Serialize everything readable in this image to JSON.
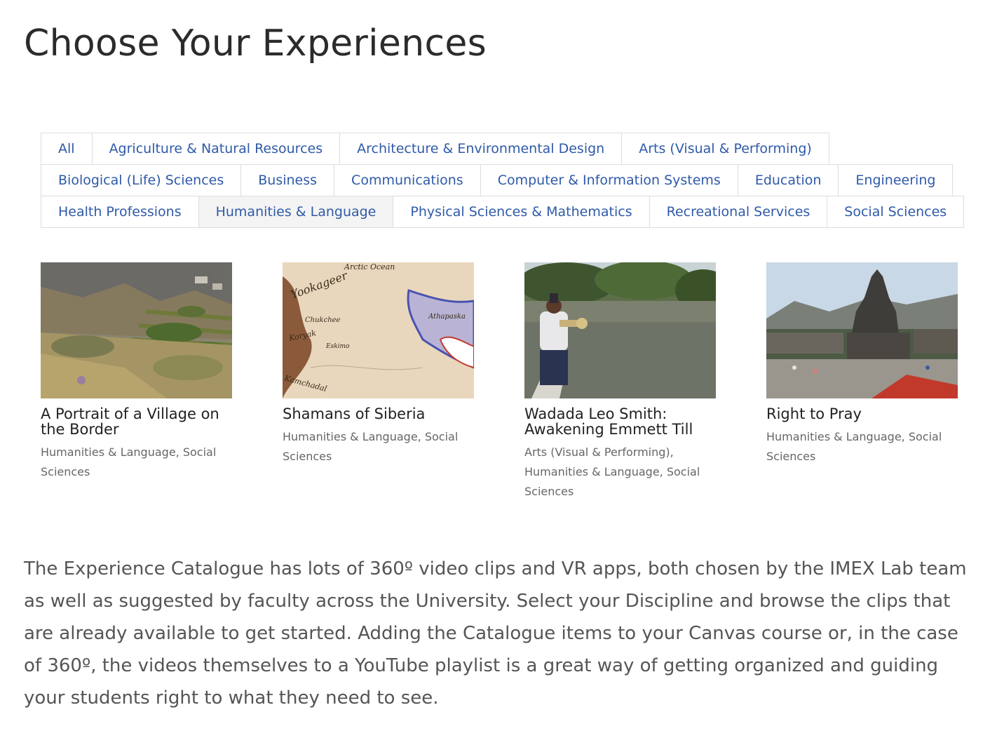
{
  "page": {
    "title": "Choose Your Experiences"
  },
  "filters": {
    "rows": [
      [
        "All",
        "Agriculture & Natural Resources",
        "Architecture & Environmental Design",
        "Arts (Visual & Performing)"
      ],
      [
        "Biological (Life) Sciences",
        "Business",
        "Communications",
        "Computer & Information Systems",
        "Education",
        "Engineering"
      ],
      [
        "Health Professions",
        "Humanities & Language",
        "Physical Sciences & Mathematics",
        "Recreational Services",
        "Social Sciences"
      ]
    ],
    "active": "Humanities & Language"
  },
  "cards": [
    {
      "title": "A Portrait of a Village on the Border",
      "tags": "Humanities & Language, Social Sciences",
      "image": "village-hillside-terraces"
    },
    {
      "title": "Shamans of Siberia",
      "tags": "Humanities & Language, Social Sciences",
      "image": "antique-map-siberia",
      "map_labels": [
        "Arctic Ocean",
        "Yookageer",
        "Chukchee",
        "Koryak",
        "Eskimo",
        "Athapaska",
        "Kamchadal"
      ]
    },
    {
      "title": "Wadada Leo Smith: Awakening Emmett Till",
      "tags": "Arts (Visual & Performing), Humanities & Language, Social Sciences",
      "image": "trumpeter-on-river-boat"
    },
    {
      "title": "Right to Pray",
      "tags": "Humanities & Language, Social Sciences",
      "image": "temple-panorama"
    }
  ],
  "description": "The Experience Catalogue has lots of 360º video clips and VR apps, both chosen by the IMEX Lab team as well as suggested by faculty across the University. Select your Discipline and browse the clips that are already available to get started. Adding the Catalogue items to your Canvas course or, in the case of 360º, the videos themselves to a YouTube playlist is a great way of getting organized and guiding your students right to what they need to see.",
  "colors": {
    "link": "#2f5aa8",
    "title": "#2b2b2b",
    "body_text": "#555555",
    "tag_text": "#666666",
    "tab_border": "#dddddd",
    "active_tab_bg": "#f4f4f4"
  }
}
